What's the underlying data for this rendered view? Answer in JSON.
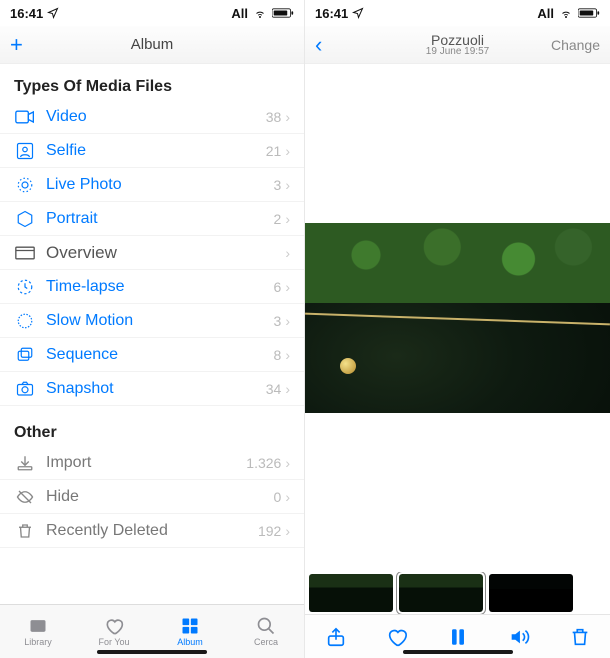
{
  "status": {
    "time": "16:41",
    "carrier": "All"
  },
  "left_pane": {
    "nav_title": "Album",
    "section1_header": "Types Of Media Files",
    "media_types": [
      {
        "key": "video",
        "label": "Video",
        "count": "38"
      },
      {
        "key": "selfie",
        "label": "Selfie",
        "count": "21"
      },
      {
        "key": "livephoto",
        "label": "Live Photo",
        "count": "3"
      },
      {
        "key": "portrait",
        "label": "Portrait",
        "count": "2"
      },
      {
        "key": "overview",
        "label": "Overview",
        "count": ""
      },
      {
        "key": "timelapse",
        "label": "Time-lapse",
        "count": "6"
      },
      {
        "key": "slowmo",
        "label": "Slow Motion",
        "count": "3"
      },
      {
        "key": "sequence",
        "label": "Sequence",
        "count": "8"
      },
      {
        "key": "snapshot",
        "label": "Snapshot",
        "count": "34"
      }
    ],
    "section2_header": "Other",
    "other": [
      {
        "key": "import",
        "label": "Import",
        "count": "1.326"
      },
      {
        "key": "hide",
        "label": "Hide",
        "count": "0"
      },
      {
        "key": "recent",
        "label": "Recently Deleted",
        "count": "192"
      }
    ],
    "tabs": {
      "library": "Library",
      "foryou": "For You",
      "album": "Album",
      "search": "Cerca"
    }
  },
  "right_pane": {
    "nav_title": "Pozzuoli",
    "nav_subtitle": "19 June 19:57",
    "nav_right": "Change"
  }
}
